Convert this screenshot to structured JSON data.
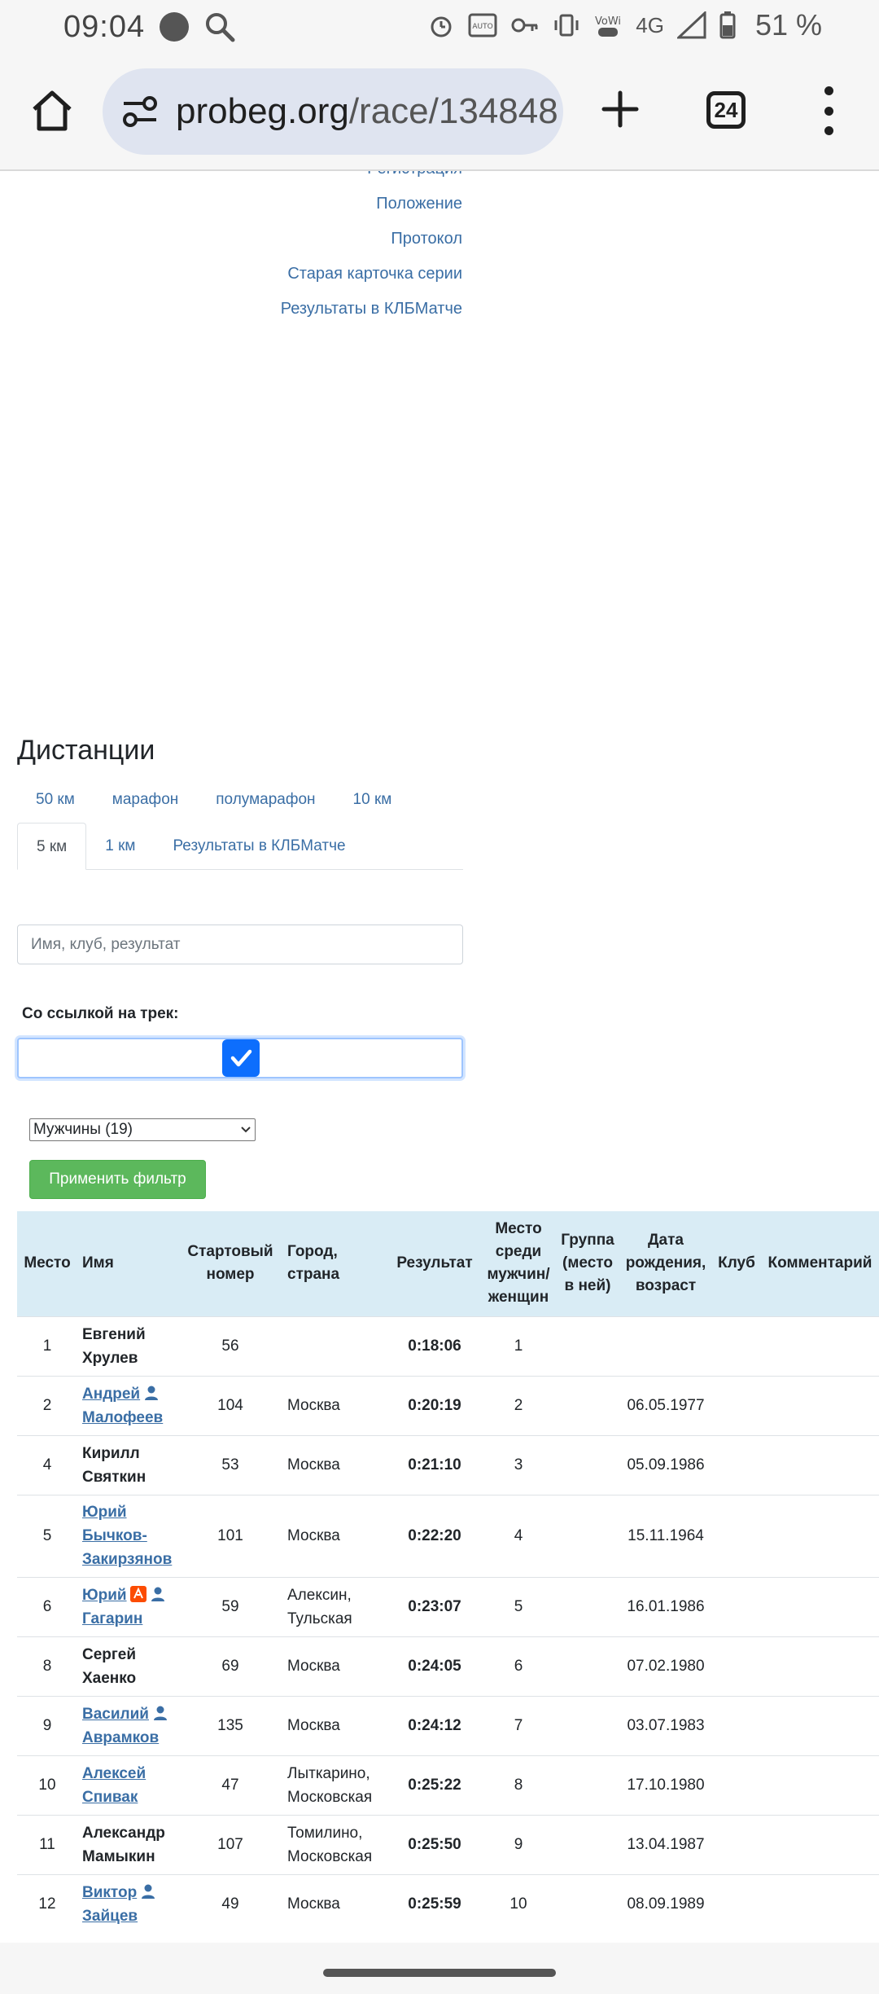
{
  "status_bar": {
    "time": "09:04",
    "network": "4G",
    "battery_percent": "51 %"
  },
  "browser": {
    "url_host": "probeg.org",
    "url_path": "/race/134848",
    "tab_count": "24"
  },
  "side_links": [
    "Регистрация",
    "Положение",
    "Протокол",
    "Старая карточка серии",
    "Результаты в КЛБМатче"
  ],
  "distances": {
    "title": "Дистанции",
    "row1": [
      "50 км",
      "марафон",
      "полумарафон",
      "10 км"
    ],
    "row2": [
      "5 км",
      "1 км",
      "Результаты в КЛБМатче"
    ],
    "active": "5 км"
  },
  "filter": {
    "search_placeholder": "Имя, клуб, результат",
    "track_label": "Со ссылкой на трек:",
    "track_checked": true,
    "gender_select": "Мужчины (19)",
    "apply_button": "Применить фильтр",
    "apply_color": "#5cb85c"
  },
  "table": {
    "header_bg": "#d9ecf5",
    "columns": {
      "place": "Место",
      "name": "Имя",
      "bib": "Стартовый номер",
      "city": "Город, страна",
      "result": "Результат",
      "gender_place": "Место среди мужчин/ женщин",
      "group": "Группа (место в ней)",
      "dob": "Дата рождения, возраст",
      "club": "Клуб",
      "comment": "Комментарий"
    },
    "rows": [
      {
        "place": "1",
        "first": "Евгений",
        "last": "Хрулев",
        "bib": "56",
        "city": "",
        "result": "0:18:06",
        "gplace": "1",
        "dob": ""
      },
      {
        "place": "2",
        "first": "Андрей",
        "last": "Малофеев",
        "bib": "104",
        "city": "Москва",
        "result": "0:20:19",
        "gplace": "2",
        "dob": "06.05.1977"
      },
      {
        "place": "4",
        "first": "Кирилл",
        "last": "Святкин",
        "bib": "53",
        "city": "Москва",
        "result": "0:21:10",
        "gplace": "3",
        "dob": "05.09.1986"
      },
      {
        "place": "5",
        "first": "Юрий",
        "last": "Бычков-Закирзянов",
        "last_a": "Бычков-",
        "last_b": "Закирзянов",
        "bib": "101",
        "city": "Москва",
        "result": "0:22:20",
        "gplace": "4",
        "dob": "15.11.1964"
      },
      {
        "place": "6",
        "first": "Юрий",
        "last": "Гагарин",
        "bib": "59",
        "city_a": "Алексин,",
        "city_b": "Тульская",
        "result": "0:23:07",
        "gplace": "5",
        "dob": "16.01.1986"
      },
      {
        "place": "8",
        "first": "Сергей",
        "last": "Хаенко",
        "bib": "69",
        "city": "Москва",
        "result": "0:24:05",
        "gplace": "6",
        "dob": "07.02.1980"
      },
      {
        "place": "9",
        "first": "Василий",
        "last": "Аврамков",
        "bib": "135",
        "city": "Москва",
        "result": "0:24:12",
        "gplace": "7",
        "dob": "03.07.1983"
      },
      {
        "place": "10",
        "first": "Алексей",
        "last": "Спивак",
        "bib": "47",
        "city_a": "Лыткарино,",
        "city_b": "Московская",
        "result": "0:25:22",
        "gplace": "8",
        "dob": "17.10.1980"
      },
      {
        "place": "11",
        "first": "Александр",
        "last": "Мамыкин",
        "bib": "107",
        "city_a": "Томилино,",
        "city_b": "Московская",
        "result": "0:25:50",
        "gplace": "9",
        "dob": "13.04.1987"
      },
      {
        "place": "12",
        "first": "Виктор",
        "last": "Зайцев",
        "bib": "49",
        "city": "Москва",
        "result": "0:25:59",
        "gplace": "10",
        "dob": "08.09.1989"
      }
    ]
  }
}
